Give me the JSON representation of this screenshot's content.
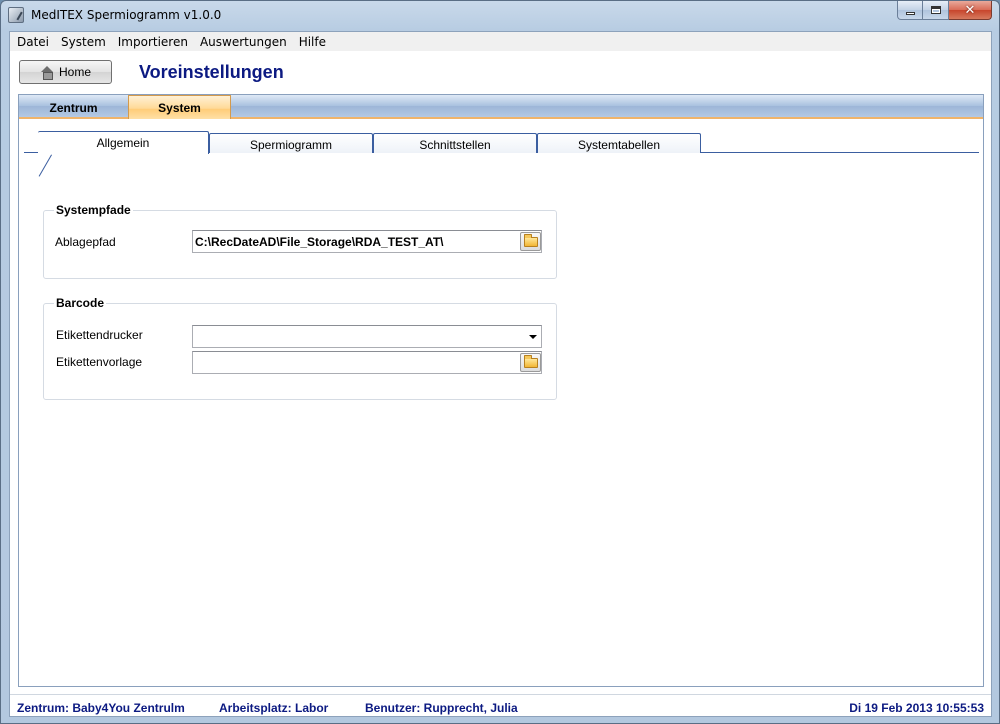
{
  "window": {
    "title": "MedITEX Spermiogramm v1.0.0",
    "accent": "#0c1a82",
    "tab_active_color": "#ffd996"
  },
  "menu": [
    "Datei",
    "System",
    "Importieren",
    "Auswertungen",
    "Hilfe"
  ],
  "header": {
    "home_label": "Home",
    "page_title": "Voreinstellungen"
  },
  "outer_tabs": [
    {
      "label": "Zentrum",
      "active": false
    },
    {
      "label": "System",
      "active": true
    }
  ],
  "inner_tabs": [
    {
      "label": "Allgemein",
      "active": true
    },
    {
      "label": "Spermiogramm",
      "active": false
    },
    {
      "label": "Schnittstellen",
      "active": false
    },
    {
      "label": "Systemtabellen",
      "active": false
    }
  ],
  "systempfade": {
    "title": "Systempfade",
    "ablagepfad_label": "Ablagepfad",
    "ablagepfad_value": "C:\\RecDateAD\\File_Storage\\RDA_TEST_AT\\"
  },
  "barcode": {
    "title": "Barcode",
    "drucker_label": "Etikettendrucker",
    "drucker_value": "",
    "vorlage_label": "Etikettenvorlage",
    "vorlage_value": ""
  },
  "status": {
    "zentrum": "Zentrum: Baby4You Zentrulm",
    "arbeitsplatz": "Arbeitsplatz: Labor",
    "benutzer": "Benutzer: Rupprecht, Julia",
    "datetime": "Di 19 Feb 2013 10:55:53"
  }
}
